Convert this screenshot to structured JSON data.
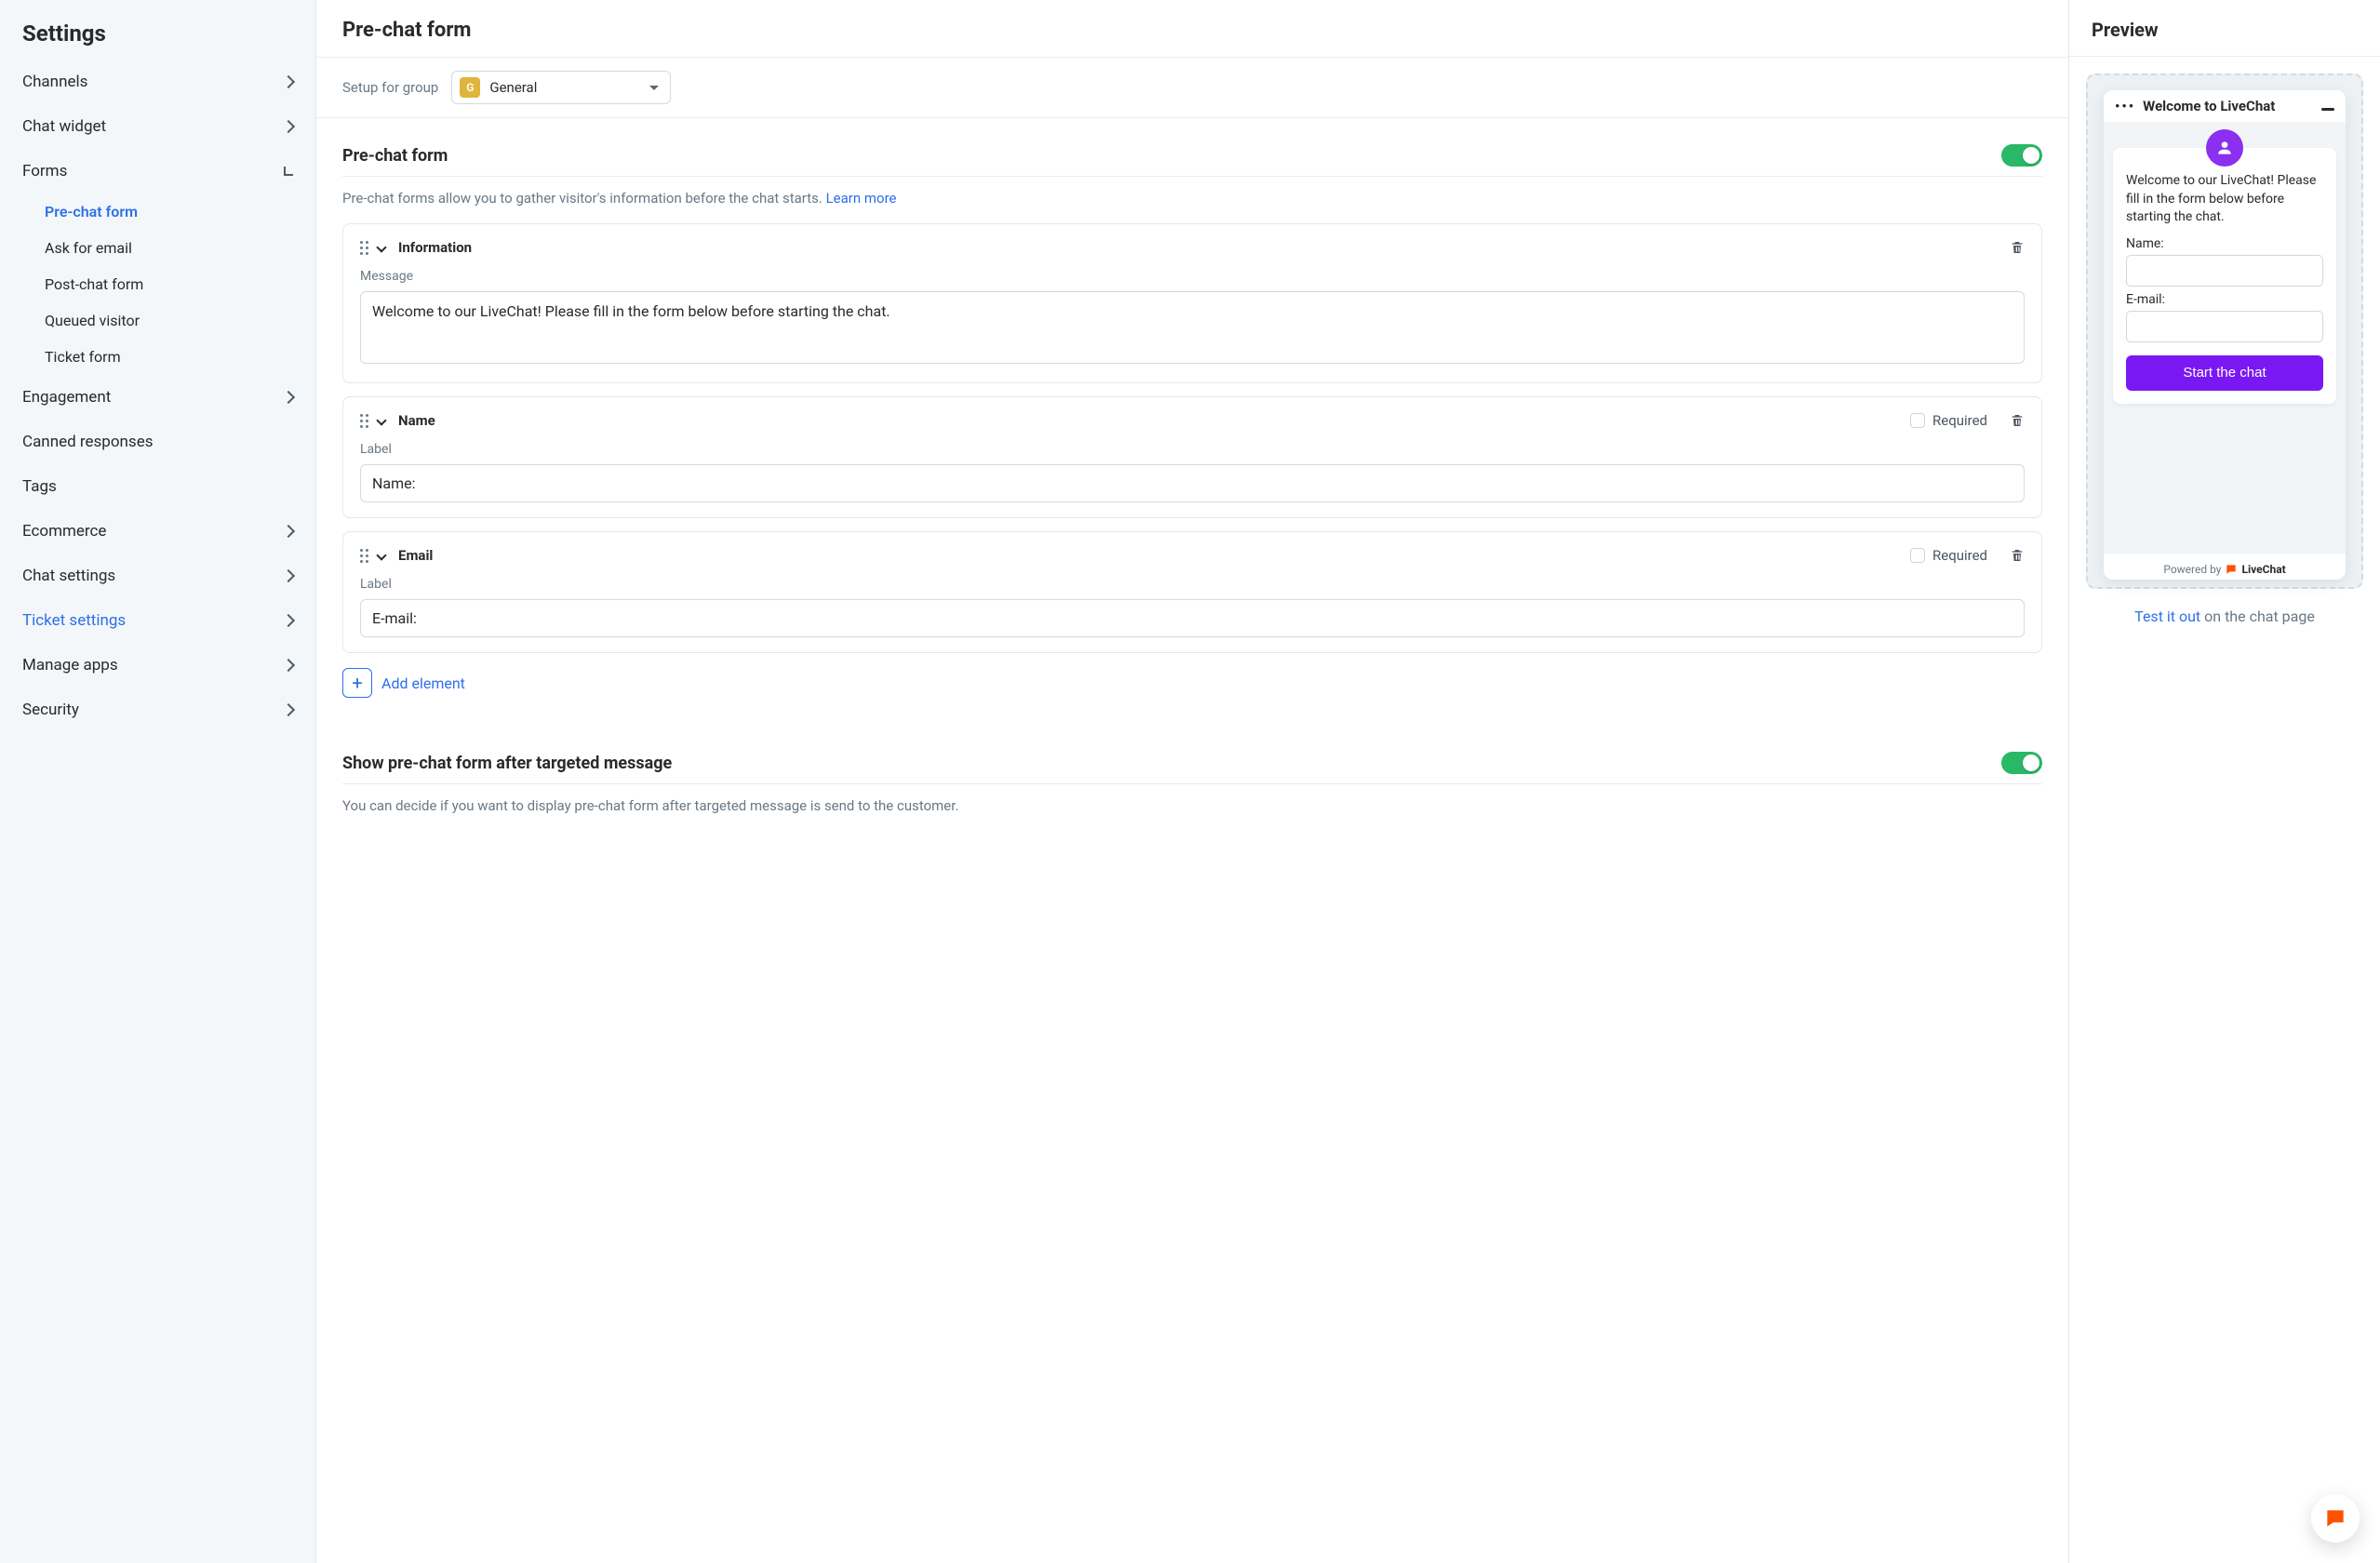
{
  "sidebar": {
    "title": "Settings",
    "items": [
      {
        "label": "Channels",
        "expandable": true
      },
      {
        "label": "Chat widget",
        "expandable": true
      },
      {
        "label": "Forms",
        "expandable": true,
        "expanded": true,
        "children": [
          {
            "label": "Pre-chat form",
            "active": true
          },
          {
            "label": "Ask for email"
          },
          {
            "label": "Post-chat form"
          },
          {
            "label": "Queued visitor"
          },
          {
            "label": "Ticket form"
          }
        ]
      },
      {
        "label": "Engagement",
        "expandable": true
      },
      {
        "label": "Canned responses",
        "expandable": false
      },
      {
        "label": "Tags",
        "expandable": false
      },
      {
        "label": "Ecommerce",
        "expandable": true
      },
      {
        "label": "Chat settings",
        "expandable": true
      },
      {
        "label": "Ticket settings",
        "expandable": true,
        "link": true
      },
      {
        "label": "Manage apps",
        "expandable": true
      },
      {
        "label": "Security",
        "expandable": true
      }
    ]
  },
  "main": {
    "page_title": "Pre-chat form",
    "group_label": "Setup for group",
    "group_badge": "G",
    "group_name": "General",
    "section1": {
      "title": "Pre-chat form",
      "help": "Pre-chat forms allow you to gather visitor's information before the chat starts. ",
      "learn_more": "Learn more"
    },
    "cards": {
      "info": {
        "title": "Information",
        "msg_label": "Message",
        "msg_value": "Welcome to our LiveChat! Please fill in the form below before starting the chat."
      },
      "name": {
        "title": "Name",
        "required_label": "Required",
        "label_label": "Label",
        "label_value": "Name:"
      },
      "email": {
        "title": "Email",
        "required_label": "Required",
        "label_label": "Label",
        "label_value": "E-mail:"
      }
    },
    "add_element": "Add element",
    "section2": {
      "title": "Show pre-chat form after targeted message",
      "help": "You can decide if you want to display pre-chat form after targeted message is send to the customer."
    }
  },
  "preview": {
    "title": "Preview",
    "chat_title": "Welcome to LiveChat",
    "msg": "Welcome to our LiveChat! Please fill in the form below before starting the chat.",
    "name_label": "Name:",
    "email_label": "E-mail:",
    "btn": "Start the chat",
    "powered_by": "Powered by",
    "brand": "LiveChat",
    "cta_link": "Test it out",
    "cta_rest": " on the chat page"
  }
}
